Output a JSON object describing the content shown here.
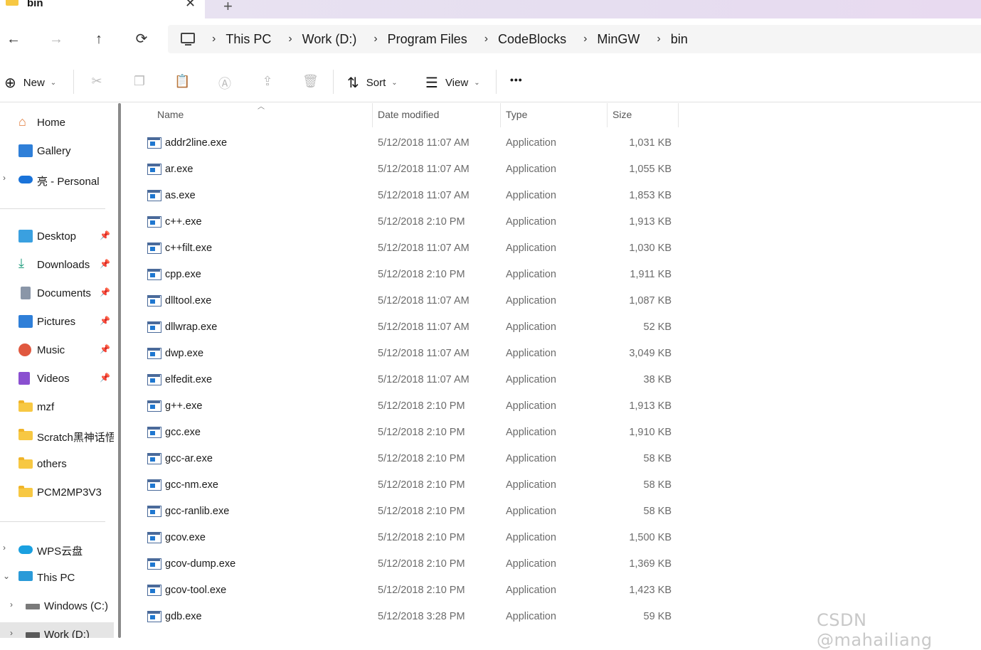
{
  "tab": {
    "title": "bin",
    "close": "✕",
    "new_tab": "+"
  },
  "nav": {
    "back": "←",
    "forward": "→",
    "up": "↑",
    "refresh": "⟳"
  },
  "breadcrumb": [
    "This PC",
    "Work (D:)",
    "Program Files",
    "CodeBlocks",
    "MinGW",
    "bin"
  ],
  "toolbar": {
    "new_label": "New",
    "sort_label": "Sort",
    "view_label": "View",
    "more_label": "•••"
  },
  "sidebar": {
    "quick": [
      {
        "label": "Home",
        "icon": "home-icon"
      },
      {
        "label": "Gallery",
        "icon": "gallery-icon"
      },
      {
        "label": "亮 - Personal",
        "icon": "onedrive-icon"
      }
    ],
    "pinned": [
      {
        "label": "Desktop",
        "icon": "desktop-icon"
      },
      {
        "label": "Downloads",
        "icon": "downloads-icon"
      },
      {
        "label": "Documents",
        "icon": "documents-icon"
      },
      {
        "label": "Pictures",
        "icon": "pictures-icon"
      },
      {
        "label": "Music",
        "icon": "music-icon"
      },
      {
        "label": "Videos",
        "icon": "videos-icon"
      },
      {
        "label": "mzf",
        "icon": "folder-icon"
      },
      {
        "label": "Scratch黑神话悟",
        "icon": "folder-icon"
      },
      {
        "label": "others",
        "icon": "folder-icon"
      },
      {
        "label": "PCM2MP3V3",
        "icon": "folder-icon"
      }
    ],
    "drives": [
      {
        "label": "WPS云盘",
        "icon": "cloud-icon"
      },
      {
        "label": "This PC",
        "icon": "computer-icon"
      },
      {
        "label": "Windows (C:)",
        "icon": "drive-icon"
      },
      {
        "label": "Work (D:)",
        "icon": "drive-icon"
      }
    ]
  },
  "columns": {
    "name": "Name",
    "date": "Date modified",
    "type": "Type",
    "size": "Size"
  },
  "files": [
    {
      "name": "addr2line.exe",
      "date": "5/12/2018 11:07 AM",
      "type": "Application",
      "size": "1,031 KB"
    },
    {
      "name": "ar.exe",
      "date": "5/12/2018 11:07 AM",
      "type": "Application",
      "size": "1,055 KB"
    },
    {
      "name": "as.exe",
      "date": "5/12/2018 11:07 AM",
      "type": "Application",
      "size": "1,853 KB"
    },
    {
      "name": "c++.exe",
      "date": "5/12/2018 2:10 PM",
      "type": "Application",
      "size": "1,913 KB"
    },
    {
      "name": "c++filt.exe",
      "date": "5/12/2018 11:07 AM",
      "type": "Application",
      "size": "1,030 KB"
    },
    {
      "name": "cpp.exe",
      "date": "5/12/2018 2:10 PM",
      "type": "Application",
      "size": "1,911 KB"
    },
    {
      "name": "dlltool.exe",
      "date": "5/12/2018 11:07 AM",
      "type": "Application",
      "size": "1,087 KB"
    },
    {
      "name": "dllwrap.exe",
      "date": "5/12/2018 11:07 AM",
      "type": "Application",
      "size": "52 KB"
    },
    {
      "name": "dwp.exe",
      "date": "5/12/2018 11:07 AM",
      "type": "Application",
      "size": "3,049 KB"
    },
    {
      "name": "elfedit.exe",
      "date": "5/12/2018 11:07 AM",
      "type": "Application",
      "size": "38 KB"
    },
    {
      "name": "g++.exe",
      "date": "5/12/2018 2:10 PM",
      "type": "Application",
      "size": "1,913 KB"
    },
    {
      "name": "gcc.exe",
      "date": "5/12/2018 2:10 PM",
      "type": "Application",
      "size": "1,910 KB"
    },
    {
      "name": "gcc-ar.exe",
      "date": "5/12/2018 2:10 PM",
      "type": "Application",
      "size": "58 KB"
    },
    {
      "name": "gcc-nm.exe",
      "date": "5/12/2018 2:10 PM",
      "type": "Application",
      "size": "58 KB"
    },
    {
      "name": "gcc-ranlib.exe",
      "date": "5/12/2018 2:10 PM",
      "type": "Application",
      "size": "58 KB"
    },
    {
      "name": "gcov.exe",
      "date": "5/12/2018 2:10 PM",
      "type": "Application",
      "size": "1,500 KB"
    },
    {
      "name": "gcov-dump.exe",
      "date": "5/12/2018 2:10 PM",
      "type": "Application",
      "size": "1,369 KB"
    },
    {
      "name": "gcov-tool.exe",
      "date": "5/12/2018 2:10 PM",
      "type": "Application",
      "size": "1,423 KB"
    },
    {
      "name": "gdb.exe",
      "date": "5/12/2018 3:28 PM",
      "type": "Application",
      "size": "59 KB"
    }
  ],
  "watermark": "CSDN @mahailiang",
  "colors": {
    "folder": "#f7c843",
    "accent": "#1f77d0",
    "tabstrip": "#e8e2f1"
  }
}
